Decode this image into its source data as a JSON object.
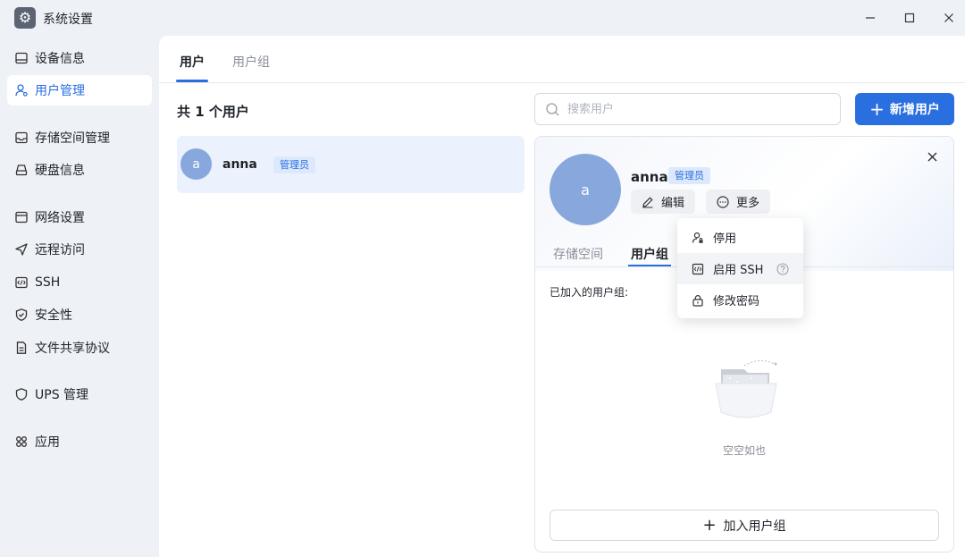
{
  "window": {
    "title": "系统设置",
    "app_icon": "gear-icon",
    "controls": [
      "minimize-icon",
      "maximize-icon",
      "close-icon"
    ]
  },
  "sidebar": {
    "items": [
      {
        "label": "设备信息",
        "icon": "device-icon",
        "active": false
      },
      {
        "label": "用户管理",
        "icon": "user-icon",
        "active": true
      },
      {
        "label": "存储空间管理",
        "icon": "storage-icon",
        "active": false
      },
      {
        "label": "硬盘信息",
        "icon": "disk-icon",
        "active": false
      },
      {
        "label": "网络设置",
        "icon": "network-icon",
        "active": false
      },
      {
        "label": "远程访问",
        "icon": "send-icon",
        "active": false
      },
      {
        "label": "SSH",
        "icon": "terminal-icon",
        "active": false
      },
      {
        "label": "安全性",
        "icon": "shield-icon",
        "active": false
      },
      {
        "label": "文件共享协议",
        "icon": "file-icon",
        "active": false
      },
      {
        "label": "UPS 管理",
        "icon": "ups-icon",
        "active": false
      },
      {
        "label": "应用",
        "icon": "apps-icon",
        "active": false
      }
    ]
  },
  "main": {
    "tabs": [
      {
        "label": "用户",
        "active": true
      },
      {
        "label": "用户组",
        "active": false
      }
    ],
    "user_count": "共 1 个用户",
    "search": {
      "placeholder": "搜索用户",
      "value": ""
    },
    "add_user_label": "新增用户",
    "users": [
      {
        "avatar": "a",
        "name": "anna",
        "role": "管理员"
      }
    ]
  },
  "detail": {
    "avatar": "a",
    "name": "anna",
    "role": "管理员",
    "edit_label": "编辑",
    "more_label": "更多",
    "subtabs": [
      {
        "label": "存储空间",
        "active": false
      },
      {
        "label": "用户组",
        "active": true
      }
    ],
    "joined_label": "已加入的用户组:",
    "empty_text": "空空如也",
    "join_button": "加入用户组"
  },
  "more_menu": {
    "items": [
      {
        "label": "停用",
        "icon": "user-disable-icon"
      },
      {
        "label": "启用 SSH",
        "icon": "terminal-icon",
        "help": true
      },
      {
        "label": "修改密码",
        "icon": "lock-icon"
      }
    ]
  },
  "colors": {
    "accent": "#2a6fe0",
    "badge_bg": "#dce8fb",
    "avatar": "#88a7dc",
    "sidebar_bg": "#eef1f6"
  }
}
